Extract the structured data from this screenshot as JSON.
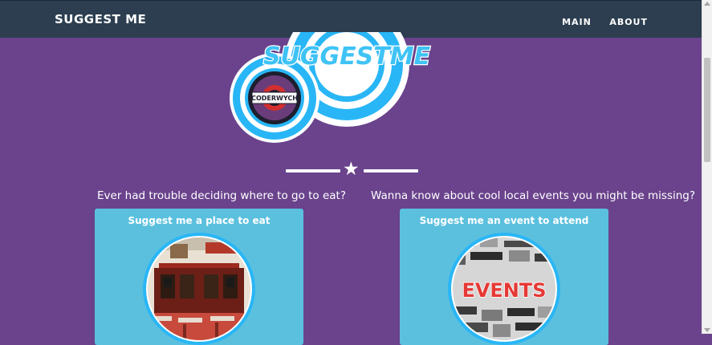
{
  "navbar": {
    "brand": "SUGGEST ME",
    "links": [
      "MAIN",
      "ABOUT"
    ]
  },
  "logo": {
    "title": "SUGGESTME",
    "badge": "CODERWYCH"
  },
  "sections": [
    {
      "question": "Ever had trouble deciding where to go to eat?",
      "card_title": "Suggest me a place to eat"
    },
    {
      "question": "Wanna know about cool local events you might be missing?",
      "card_title": "Suggest me an event to attend",
      "image_text": "EVENTS"
    }
  ],
  "colors": {
    "background": "#6a438c",
    "navbar": "#2c3e50",
    "card": "#5bc0de",
    "logo_ring": "#29b6f6"
  },
  "icons": {
    "divider": "star-icon"
  }
}
